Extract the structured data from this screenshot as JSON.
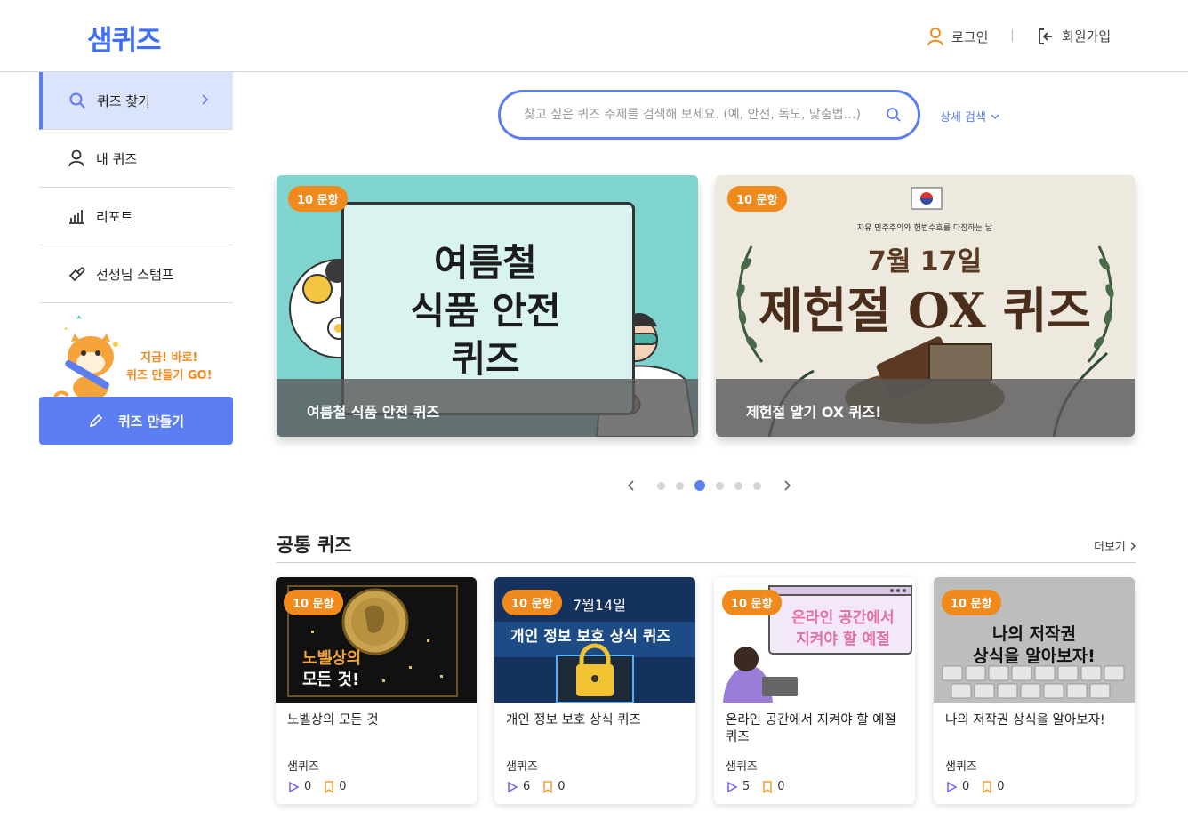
{
  "header": {
    "logo": "샘퀴즈",
    "login_label": "로그인",
    "join_label": "회원가입"
  },
  "sidebar": {
    "items": [
      {
        "label": "퀴즈 찾기"
      },
      {
        "label": "내 퀴즈"
      },
      {
        "label": "리포트"
      },
      {
        "label": "선생님 스탬프"
      }
    ],
    "promo_line1": "지금! 바로!",
    "promo_line2": "퀴즈 만들기 GO!",
    "make_button": "퀴즈 만들기"
  },
  "search": {
    "placeholder": "찾고 싶은 퀴즈 주제를 검색해 보세요. (예, 안전, 독도, 맞춤법…)",
    "advanced_label": "상세 검색"
  },
  "banners": [
    {
      "badge": "10 문항",
      "art_line1": "여름철",
      "art_line2": "식품 안전",
      "art_line3": "퀴즈",
      "caption": "여름철 식품 안전 퀴즈"
    },
    {
      "badge": "10 문항",
      "art_top": "자유 민주주의와 헌법수호를 다짐하는 날",
      "art_date": "7월 17일",
      "art_title": "제헌절 OX 퀴즈",
      "caption": "제헌절 알기 OX 퀴즈!"
    }
  ],
  "carousel": {
    "count": 6,
    "active": 2
  },
  "section": {
    "title": "공통 퀴즈",
    "more_label": "더보기"
  },
  "cards": [
    {
      "badge": "10 문항",
      "thumb_line1": "노벨상의",
      "thumb_line2": "모든 것!",
      "title": "노벨상의 모든 것",
      "author": "샘퀴즈",
      "plays": "0",
      "saves": "0"
    },
    {
      "badge": "10 문항",
      "thumb_date": "7월14일",
      "thumb_title": "개인 정보 보호 상식 퀴즈",
      "title": "개인 정보 보호 상식 퀴즈",
      "author": "샘퀴즈",
      "plays": "6",
      "saves": "0"
    },
    {
      "badge": "10 문항",
      "thumb_line1": "온라인 공간에서",
      "thumb_line2": "지켜야 할 예절",
      "title": "온라인 공간에서 지켜야 할 예절 퀴즈",
      "author": "샘퀴즈",
      "plays": "5",
      "saves": "0"
    },
    {
      "badge": "10 문항",
      "thumb_line1": "나의 저작권",
      "thumb_line2": "상식을 알아보자!",
      "title": "나의 저작권 상식을 알아보자!",
      "author": "샘퀴즈",
      "plays": "0",
      "saves": "0"
    }
  ],
  "colors": {
    "accent": "#5b7ef2",
    "logo": "#3d6ef5",
    "badge": "#f08a1c",
    "sidebar_active": "#dce3fd"
  }
}
